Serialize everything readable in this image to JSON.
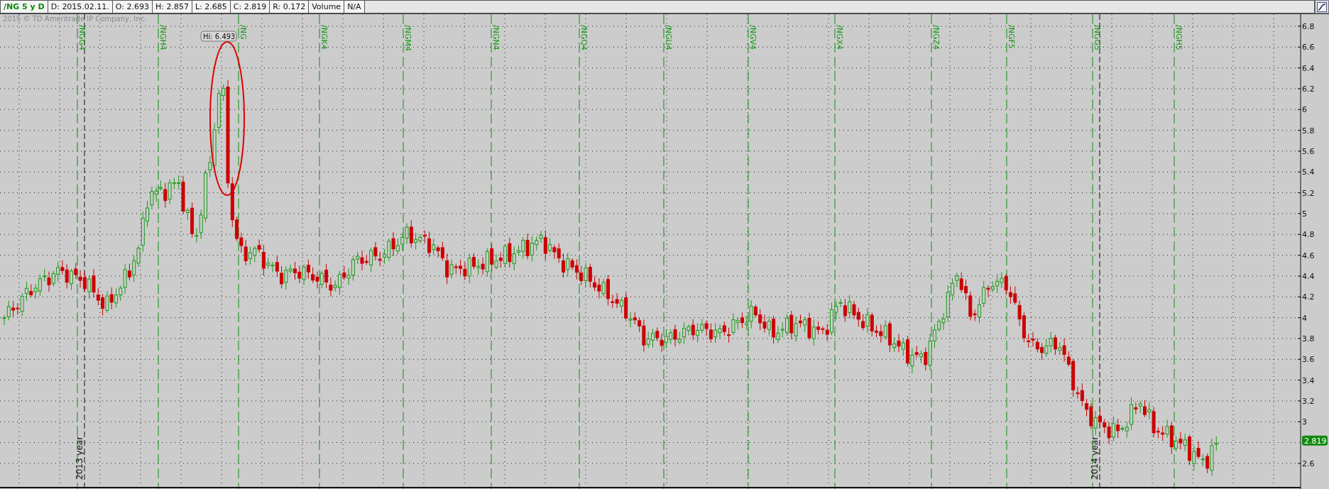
{
  "header": {
    "symbol": "/NG 5 y D",
    "fields": [
      "D: 2015.02.11.",
      "O: 2.693",
      "H: 2.857",
      "L: 2.685",
      "C: 2.819",
      "R: 0.172",
      "Volume",
      "N/A"
    ]
  },
  "chart": {
    "copyright": "2015 © TD Ameritrade IP Company, Inc.",
    "contract_labels": [
      "/NGG4",
      "/NGH4",
      "/NG",
      "/NGK4",
      "/NGM4",
      "/NGN4",
      "/NGQ4",
      "/NGU4",
      "/NGV4",
      "/NGX4",
      "/NGZ4",
      "/NGF5",
      "/NGG5",
      "/NGH5"
    ],
    "year_labels": [
      "2013 year",
      "2014 year"
    ],
    "price_ticks": [
      "6.8",
      "6.6",
      "6.4",
      "6.2",
      "6",
      "5.8",
      "5.6",
      "5.4",
      "5.2",
      "5",
      "4.8",
      "4.6",
      "4.4",
      "4.2",
      "4",
      "3.8",
      "3.6",
      "3.4",
      "3.2",
      "3",
      "2.6"
    ],
    "high_marker": "Hi: 6.493",
    "last_price": "2.819"
  }
}
